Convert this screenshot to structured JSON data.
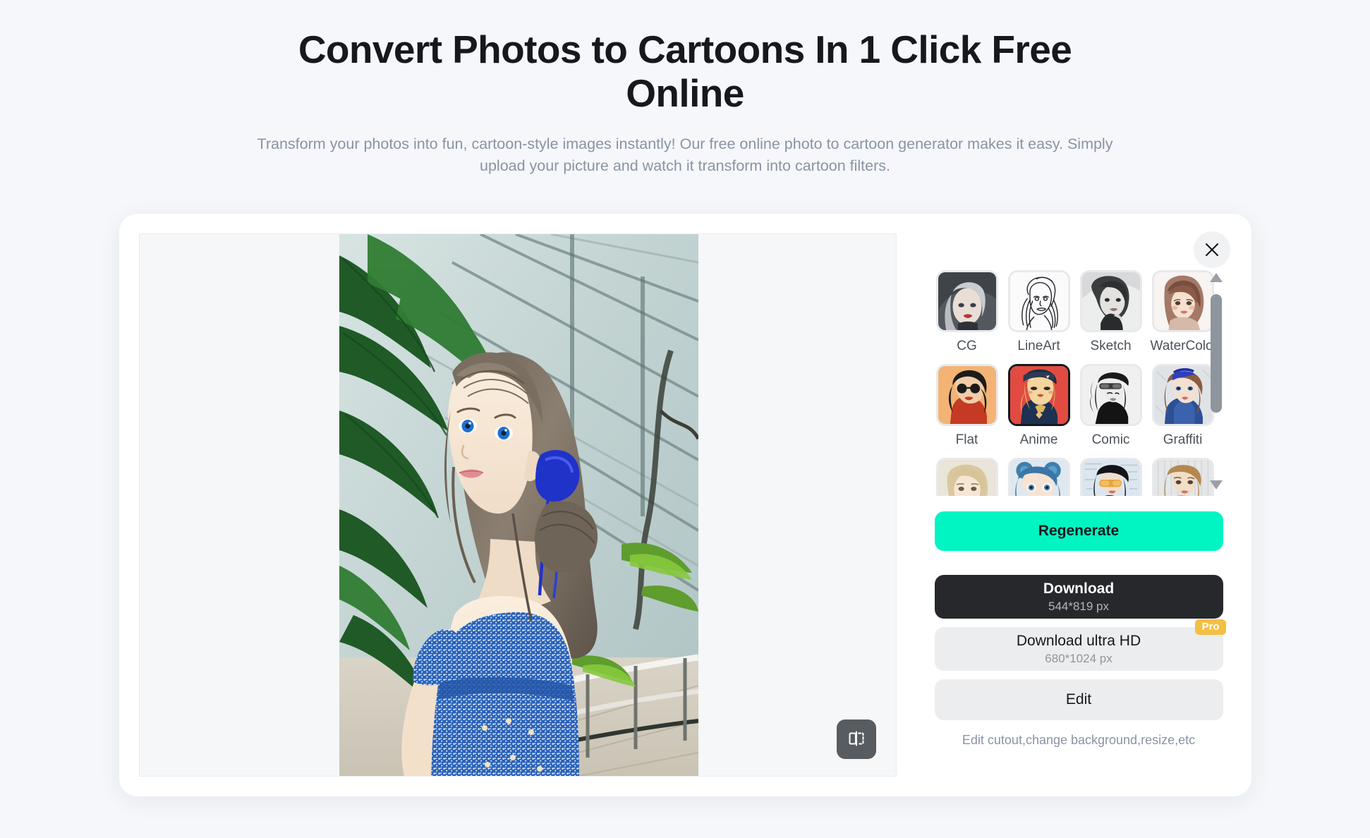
{
  "hero": {
    "title": "Convert Photos to Cartoons In 1 Click Free Online",
    "subtitle": "Transform your photos into fun, cartoon-style images instantly! Our free online photo to cartoon generator makes it easy. Simply upload your picture and watch it transform into cartoon filters."
  },
  "editor": {
    "close_label": "×",
    "compare_tooltip": "Compare",
    "styles": [
      {
        "label": "CG",
        "selected": false,
        "theme": "cg"
      },
      {
        "label": "LineArt",
        "selected": false,
        "theme": "lineart"
      },
      {
        "label": "Sketch",
        "selected": false,
        "theme": "sketch"
      },
      {
        "label": "WaterColor",
        "selected": false,
        "theme": "watercolor"
      },
      {
        "label": "Flat",
        "selected": false,
        "theme": "flat"
      },
      {
        "label": "Anime",
        "selected": true,
        "theme": "anime"
      },
      {
        "label": "Comic",
        "selected": false,
        "theme": "comic"
      },
      {
        "label": "Graffiti",
        "selected": false,
        "theme": "graffiti"
      },
      {
        "label": "",
        "selected": false,
        "theme": "row3a"
      },
      {
        "label": "",
        "selected": false,
        "theme": "row3b"
      },
      {
        "label": "",
        "selected": false,
        "theme": "row3c"
      },
      {
        "label": "",
        "selected": false,
        "theme": "row3d"
      }
    ],
    "regenerate_label": "Regenerate",
    "download": {
      "label": "Download",
      "size": "544*819 px"
    },
    "download_ultra": {
      "label": "Download ultra HD",
      "size": "680*1024 px",
      "badge": "Pro"
    },
    "edit": {
      "label": "Edit",
      "hint": "Edit cutout,change background,resize,etc"
    }
  },
  "colors": {
    "page_bg": "#f5f7fa",
    "accent": "#00f5c2",
    "dark": "#26282c",
    "muted": "#8a93a5",
    "pro_badge": "#f5bf43"
  }
}
